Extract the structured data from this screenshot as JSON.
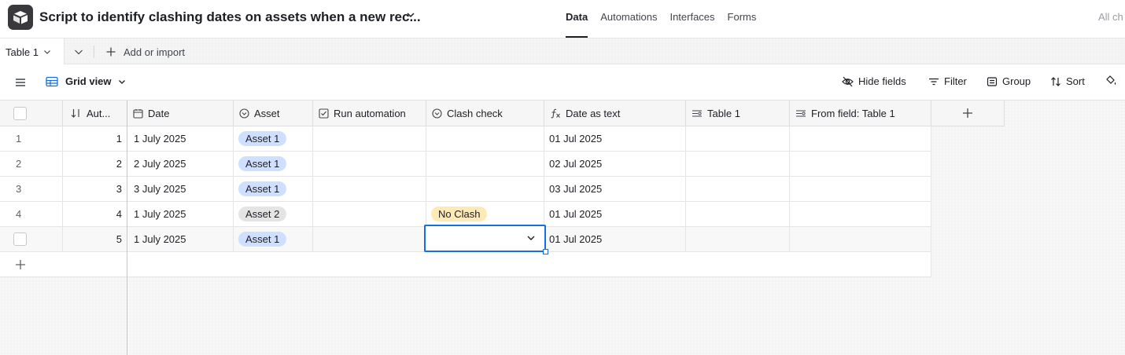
{
  "app": {
    "base_title": "Script to identify clashing dates on assets when a new rec...",
    "nav_tabs": [
      "Data",
      "Automations",
      "Interfaces",
      "Forms"
    ],
    "active_tab": "Data",
    "nav_right_text": "All ch"
  },
  "tables_bar": {
    "active_table": "Table 1",
    "add_import_label": "Add or import"
  },
  "view_toolbar": {
    "view_name": "Grid view",
    "hide_fields": "Hide fields",
    "filter": "Filter",
    "group": "Group",
    "sort": "Sort"
  },
  "grid": {
    "columns": [
      "Aut...",
      "Date",
      "Asset",
      "Run automation",
      "Clash check",
      "Date as text",
      "Table 1",
      "From field: Table 1"
    ],
    "rows": [
      {
        "n": "1",
        "aut": "1",
        "date": "1 July 2025",
        "asset": "Asset 1",
        "clash": "",
        "date_text": "01 Jul 2025"
      },
      {
        "n": "2",
        "aut": "2",
        "date": "2 July 2025",
        "asset": "Asset 1",
        "clash": "",
        "date_text": "02 Jul 2025"
      },
      {
        "n": "3",
        "aut": "3",
        "date": "3 July 2025",
        "asset": "Asset 1",
        "clash": "",
        "date_text": "03 Jul 2025"
      },
      {
        "n": "4",
        "aut": "4",
        "date": "1 July 2025",
        "asset": "Asset 2",
        "clash": "No Clash",
        "date_text": "01 Jul 2025"
      },
      {
        "n": "",
        "aut": "5",
        "date": "1 July 2025",
        "asset": "Asset 1",
        "clash": "",
        "date_text": "01 Jul 2025"
      }
    ]
  },
  "colors": {
    "asset1_pill": "#cfdfff",
    "asset2_pill": "#e4e4e4",
    "no_clash_pill": "#ffeab6",
    "selection_blue": "#166ee1"
  }
}
